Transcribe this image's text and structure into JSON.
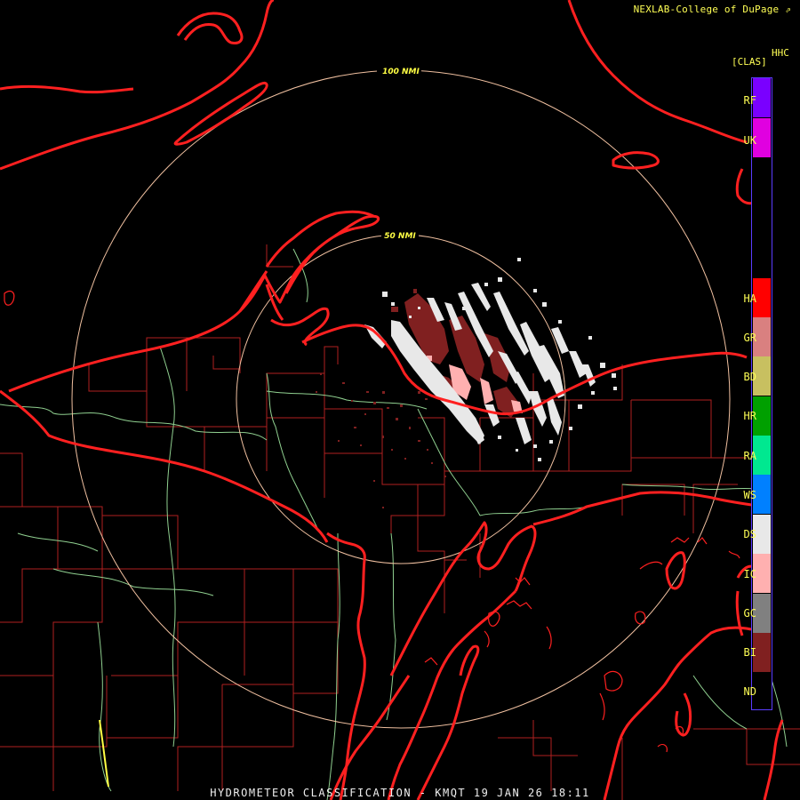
{
  "credit": "NEXLAB-College of DuPage",
  "product_code": "HHC",
  "product_tag": "[CLAS]",
  "footer": "HYDROMETEOR CLASSIFICATION - KMQT 19 JAN 26 18:11",
  "rings": [
    {
      "label": "100 NMI"
    },
    {
      "label": "50 NMI"
    }
  ],
  "legend": [
    {
      "code": "RF",
      "color": "#7a00ff"
    },
    {
      "code": "UK",
      "color": "#e000e0"
    },
    {
      "code": "HA",
      "color": "#ff0000"
    },
    {
      "code": "GR",
      "color": "#d98080"
    },
    {
      "code": "BD",
      "color": "#c8c060"
    },
    {
      "code": "HR",
      "color": "#00a000"
    },
    {
      "code": "RA",
      "color": "#00e890"
    },
    {
      "code": "WS",
      "color": "#0080ff"
    },
    {
      "code": "DS",
      "color": "#e8e8e8"
    },
    {
      "code": "IC",
      "color": "#ffb0b0"
    },
    {
      "code": "GC",
      "color": "#808080"
    },
    {
      "code": "BI",
      "color": "#802020"
    },
    {
      "code": "ND",
      "color": "#000000"
    }
  ],
  "colors": {
    "state_border": "#ff2020",
    "county_line": "#b02020",
    "river": "#90d090",
    "range_ring": "#f0c0a0"
  }
}
